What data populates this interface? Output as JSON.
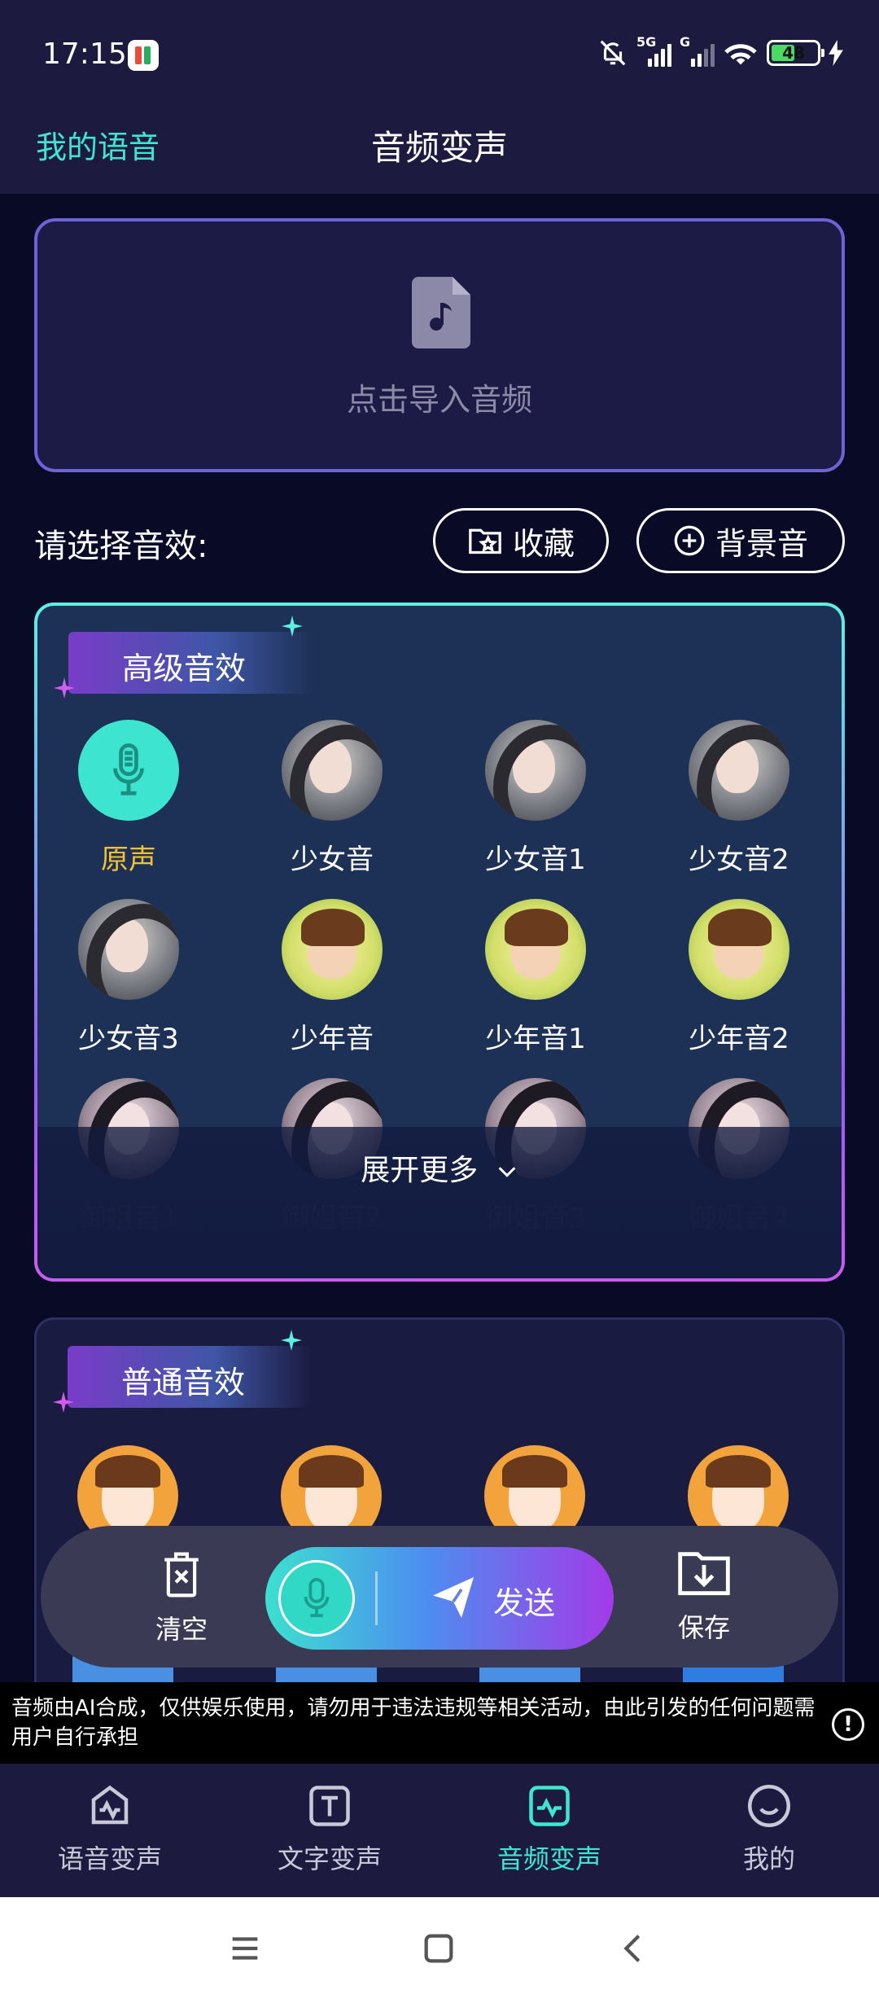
{
  "status_bar": {
    "time": "17:15",
    "network_1": "5G",
    "network_2": "G",
    "battery": "48"
  },
  "header": {
    "left_link": "我的语音",
    "title": "音频变声"
  },
  "import": {
    "text": "点击导入音频",
    "icon": "music-file-icon"
  },
  "effects_bar": {
    "label": "请选择音效:",
    "favorites": "收藏",
    "background": "背景音"
  },
  "premium": {
    "title": "高级音效",
    "items": [
      {
        "name": "原声",
        "avatar": "mic-icon",
        "selected": true
      },
      {
        "name": "少女音",
        "avatar": "girl"
      },
      {
        "name": "少女音1",
        "avatar": "girl"
      },
      {
        "name": "少女音2",
        "avatar": "girl"
      },
      {
        "name": "少女音3",
        "avatar": "girl"
      },
      {
        "name": "少年音",
        "avatar": "boy"
      },
      {
        "name": "少年音1",
        "avatar": "boy"
      },
      {
        "name": "少年音2",
        "avatar": "boy"
      },
      {
        "name": "御姐音1",
        "avatar": "yujie"
      },
      {
        "name": "御姐音2",
        "avatar": "yujie"
      },
      {
        "name": "御姐音3",
        "avatar": "yujie"
      },
      {
        "name": "御姐音4",
        "avatar": "yujie"
      }
    ],
    "expand": "展开更多"
  },
  "normal": {
    "title": "普通音效"
  },
  "action_bar": {
    "clear": "清空",
    "send": "发送",
    "save": "保存"
  },
  "disclaimer": "音频由AI合成，仅供娱乐使用，请勿用于违法违规等相关活动，由此引发的任何问题需用户自行承担",
  "bottom_nav": [
    {
      "label": "语音变声",
      "icon": "voice-wave-icon"
    },
    {
      "label": "文字变声",
      "icon": "text-icon"
    },
    {
      "label": "音频变声",
      "icon": "audio-wave-icon",
      "active": true
    },
    {
      "label": "我的",
      "icon": "smile-icon"
    }
  ],
  "colors": {
    "accent": "#3fe6cf",
    "selected_label": "#f1c232",
    "background": "#080a26"
  }
}
